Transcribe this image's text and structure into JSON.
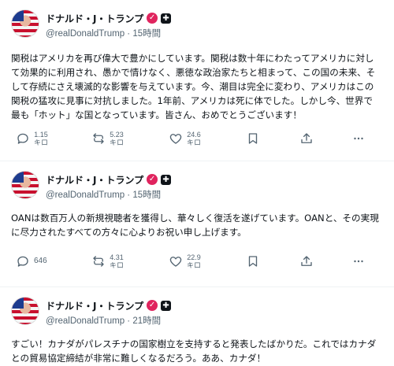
{
  "posts": [
    {
      "author": "ドナルド・J・トランプ",
      "handle": "@realDonaldTrump",
      "time": "15時間",
      "text": "関税はアメリカを再び偉大で豊かにしています。関税は数十年にわたってアメリカに対して効果的に利用され、愚かで情けなく、悪徳な政治家たちと相まって、この国の未来、そして存続にさえ壊滅的な影響を与えています。今、潮目は完全に変わり、アメリカはこの関税の猛攻に見事に対抗しました。1年前、アメリカは死に体でした。しかし今、世界で最も「ホット」な国となっています。皆さん、おめでとうございます！",
      "replies": "1.15",
      "reposts": "5.23",
      "likes": "24.6",
      "unit": "キロ"
    },
    {
      "author": "ドナルド・J・トランプ",
      "handle": "@realDonaldTrump",
      "time": "15時間",
      "text": "OANは数百万人の新規視聴者を獲得し、華々しく復活を遂げています。OANと、その実現に尽力されたすべての方々に心よりお祝い申し上げます。",
      "replies": "646",
      "reposts": "4.31",
      "likes": "22.9",
      "unit": "キロ"
    },
    {
      "author": "ドナルド・J・トランプ",
      "handle": "@realDonaldTrump",
      "time": "21時間",
      "text": "すごい！カナダがパレスチナの国家樹立を支持すると発表したばかりだ。これではカナダとの貿易協定締結が非常に難しくなるだろう。ああ、カナダ！"
    }
  ],
  "separator": "·",
  "icons": {
    "reply": "reply-icon",
    "repost": "repost-icon",
    "like": "heart-icon",
    "bookmark": "bookmark-icon",
    "share": "share-icon",
    "more": "more-icon",
    "verified": "verified-badge-icon",
    "affiliate": "affiliate-badge-icon"
  },
  "colors": {
    "verified": "#e0245e",
    "secondary_text": "#536471",
    "text": "#0f1419"
  }
}
